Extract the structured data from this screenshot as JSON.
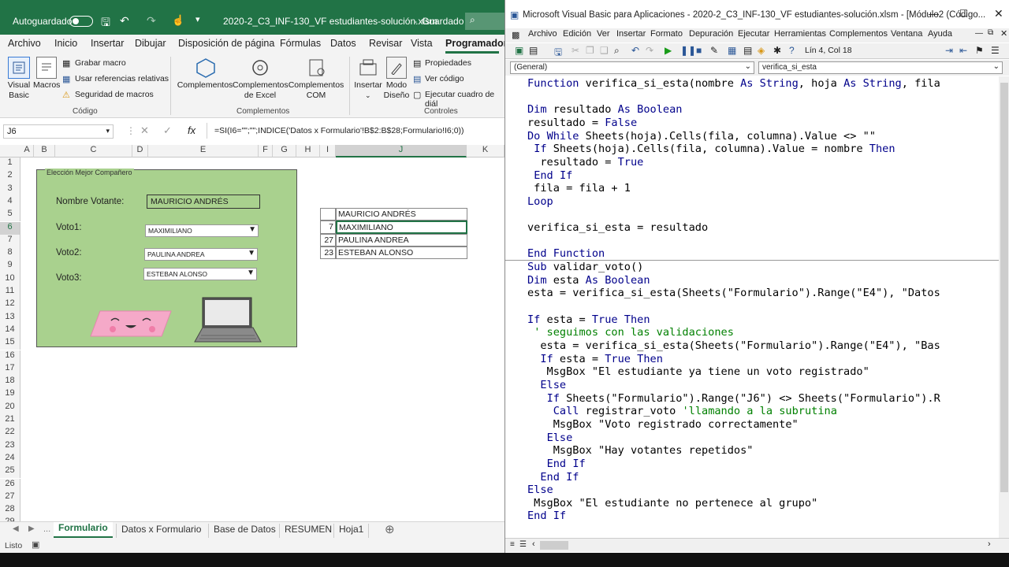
{
  "excel": {
    "autosave_label": "Autoguardado",
    "file_title": "2020-2_C3_INF-130_VF estudiantes-solución.xlsm",
    "saved_state": "Guardado",
    "tabs": [
      "Archivo",
      "Inicio",
      "Insertar",
      "Dibujar",
      "Disposición de página",
      "Fórmulas",
      "Datos",
      "Revisar",
      "Vista",
      "Programador"
    ],
    "active_tab": "Programador",
    "ribbon": {
      "visual_basic": "Visual\nBasic",
      "macros": "Macros",
      "grabar_macro": "Grabar macro",
      "usar_referencias": "Usar referencias relativas",
      "seguridad": "Seguridad de macros",
      "group_codigo": "Código",
      "complementos": "Complementos",
      "complementos_excel": "Complementos\nde Excel",
      "complementos_com": "Complementos\nCOM",
      "group_complementos": "Complementos",
      "insertar": "Insertar",
      "modo_diseno": "Modo\nDiseño",
      "propiedades": "Propiedades",
      "ver_codigo": "Ver código",
      "ejecutar_cuadro": "Ejecutar cuadro de diál",
      "group_controles": "Controles"
    },
    "name_box": "J6",
    "formula": "=SI(I6=\"\";\"\";INDICE('Datos x Formulario'!B$2:B$28;Formulario!I6;0))",
    "columns": [
      "A",
      "B",
      "C",
      "D",
      "E",
      "F",
      "G",
      "H",
      "I",
      "J",
      "K"
    ],
    "rows": [
      "1",
      "2",
      "3",
      "4",
      "5",
      "6",
      "7",
      "8",
      "9",
      "10",
      "11",
      "12",
      "13",
      "14",
      "15",
      "16",
      "17",
      "18",
      "19",
      "20",
      "21",
      "22",
      "23",
      "24",
      "25",
      "26",
      "27",
      "28",
      "29"
    ],
    "form": {
      "title": "Elección Mejor Compañero",
      "nombre_label": "Nombre Votante:",
      "nombre_value": "MAURICIO ANDRÉS",
      "voto1_label": "Voto1:",
      "voto1_value": "MAXIMILIANO",
      "voto2_label": "Voto2:",
      "voto2_value": "PAULINA ANDREA",
      "voto3_label": "Voto3:",
      "voto3_value": "ESTEBAN ALONSO"
    },
    "table": [
      {
        "i": "",
        "j": "MAURICIO ANDRÉS"
      },
      {
        "i": "7",
        "j": "MAXIMILIANO"
      },
      {
        "i": "27",
        "j": "PAULINA ANDREA"
      },
      {
        "i": "23",
        "j": "ESTEBAN ALONSO"
      }
    ],
    "sheet_tabs": [
      "Formulario",
      "Datos x Formulario",
      "Base de Datos",
      "RESUMEN",
      "Hoja1"
    ],
    "active_sheet": "Formulario",
    "status": "Listo",
    "accent": "#217346",
    "form_bg": "#a9d18e"
  },
  "vba": {
    "title": "Microsoft Visual Basic para Aplicaciones - 2020-2_C3_INF-130_VF estudiantes-solución.xlsm - [Módulo2 (Código...",
    "menu": [
      "Archivo",
      "Edición",
      "Ver",
      "Insertar",
      "Formato",
      "Depuración",
      "Ejecutar",
      "Herramientas",
      "Complementos",
      "Ventana",
      "Ayuda"
    ],
    "cursor_pos": "Lín 4, Col 18",
    "combo_left": "(General)",
    "combo_right": "verifica_si_esta",
    "code": [
      "Function verifica_si_esta(nombre As String, hoja As String, fila",
      "",
      "Dim resultado As Boolean",
      "resultado = False",
      "Do While Sheets(hoja).Cells(fila, columna).Value <> \"\"",
      " If Sheets(hoja).Cells(fila, columna).Value = nombre Then",
      "  resultado = True",
      " End If",
      " fila = fila + 1",
      "Loop",
      "",
      "verifica_si_esta = resultado",
      "",
      "End Function",
      "Sub validar_voto()",
      "Dim esta As Boolean",
      "esta = verifica_si_esta(Sheets(\"Formulario\").Range(\"E4\"), \"Datos",
      "",
      "If esta = True Then",
      " ' seguimos con las validaciones",
      "  esta = verifica_si_esta(Sheets(\"Formulario\").Range(\"E4\"), \"Bas",
      "  If esta = True Then",
      "   MsgBox \"El estudiante ya tiene un voto registrado\"",
      "  Else",
      "   If Sheets(\"Formulario\").Range(\"J6\") <> Sheets(\"Formulario\").R",
      "    Call registrar_voto 'llamando a la subrutina",
      "    MsgBox \"Voto registrado correctamente\"",
      "   Else",
      "    MsgBox \"Hay votantes repetidos\"",
      "   End If",
      "  End If",
      "Else",
      " MsgBox \"El estudiante no pertenece al grupo\"",
      "End If"
    ]
  }
}
